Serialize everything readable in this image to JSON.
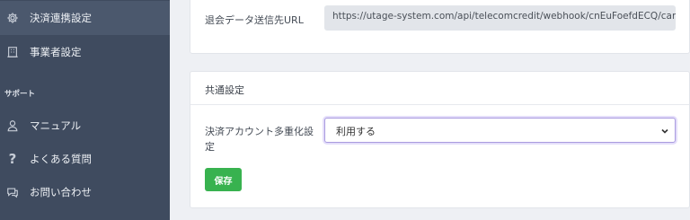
{
  "sidebar": {
    "items": [
      {
        "label": "決済連携設定",
        "icon": "gear-icon",
        "active": true
      },
      {
        "label": "事業者設定",
        "icon": "building-icon"
      }
    ],
    "section_label": "サポート",
    "support_items": [
      {
        "label": "マニュアル",
        "icon": "person-icon"
      },
      {
        "label": "よくある質問",
        "icon": "question-icon"
      },
      {
        "label": "お問い合わせ",
        "icon": "chat-icon"
      }
    ]
  },
  "webhook_card": {
    "label": "退会データ送信先URL",
    "url": "https://utage-system.com/api/telecomcredit/webhook/cnEuFoefdECQ/cancel"
  },
  "common_card": {
    "title": "共通設定",
    "field_label_line1": "決済アカウント多重化設",
    "field_label_line2": "定",
    "select_value": "利用する",
    "save_label": "保存"
  },
  "colors": {
    "sidebar_bg": "#3f4b5f",
    "sidebar_active": "#4b586d",
    "save_button": "#38b24f",
    "select_focus": "#a99bdf"
  }
}
